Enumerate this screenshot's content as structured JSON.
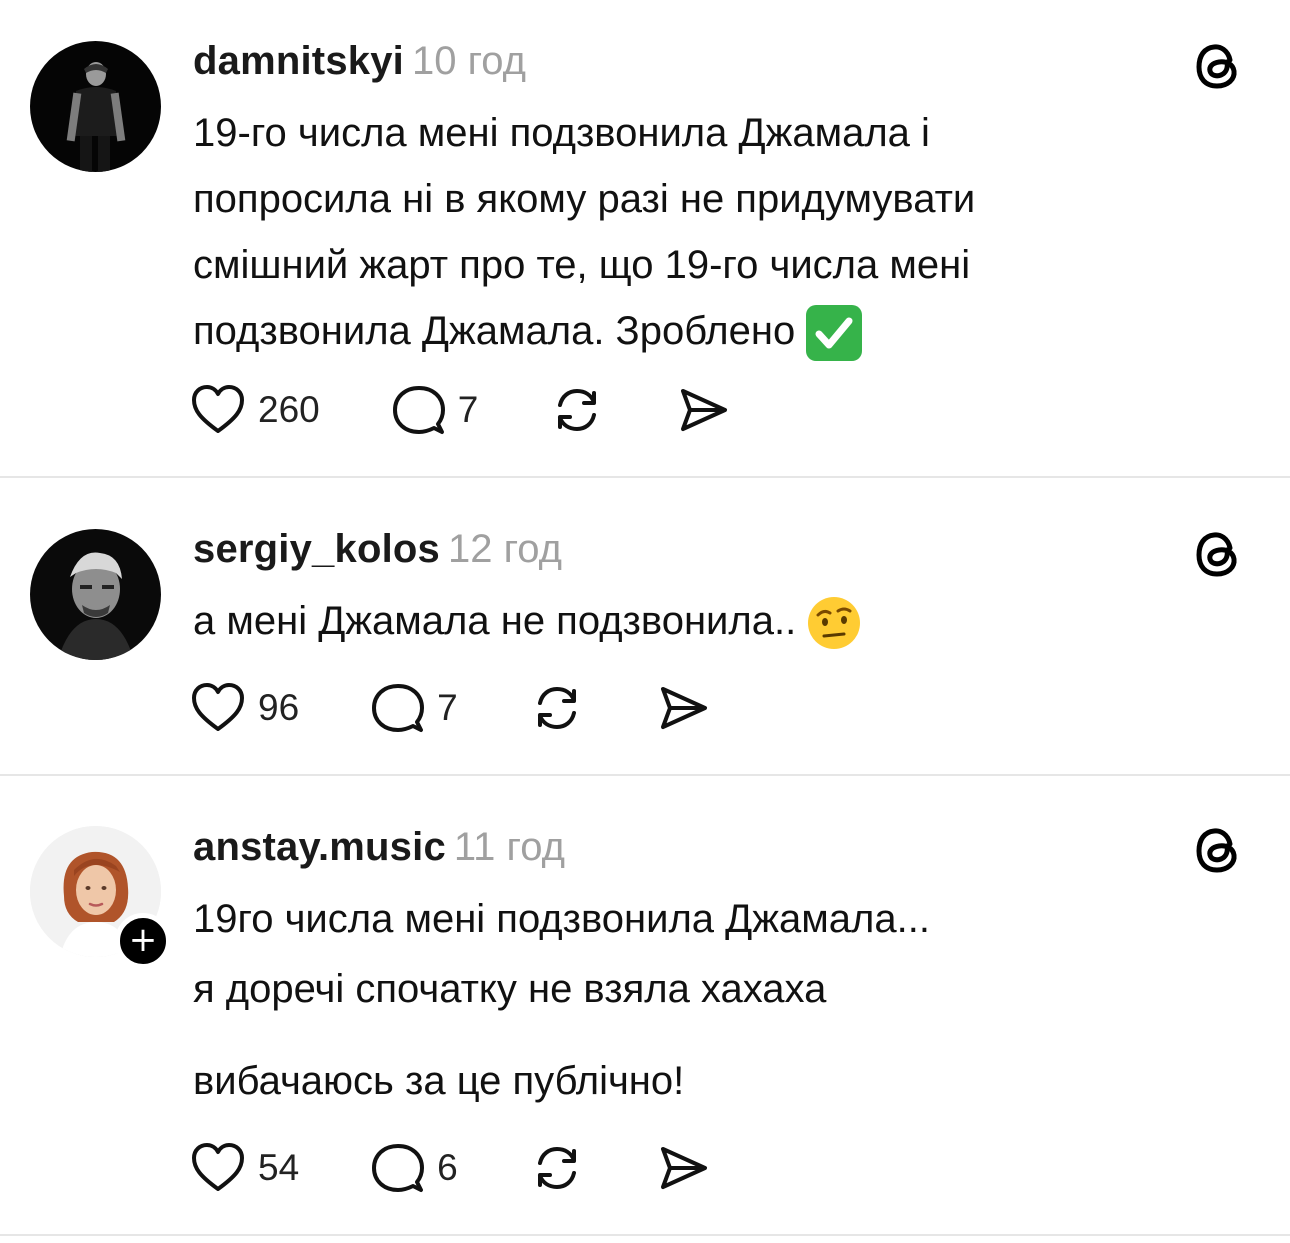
{
  "posts": [
    {
      "username": "damnitskyi",
      "time": "10 год",
      "lines": [
        "19-го числа мені подзвонила Джамала і",
        "попросила ні в якому разі не придумувати",
        "смішний жарт про те, що 19-го числа мені",
        "подзвонила Джамала. Зроблено"
      ],
      "emoji": "check-mark-button-emoji",
      "likes": "260",
      "replies": "7"
    },
    {
      "username": "sergiy_kolos",
      "time": "12 год",
      "lines": [
        "а мені Джамала не подзвонила.."
      ],
      "emoji": "face-with-raised-eyebrow-emoji",
      "likes": "96",
      "replies": "7"
    },
    {
      "username": "anstay.music",
      "time": "11 год",
      "lines": [
        "19го числа мені подзвонила Джамала...",
        "я доречі спочатку не взяла хахаха",
        "вибачаюсь за це публічно!"
      ],
      "follow_badge": "+",
      "likes": "54",
      "replies": "6"
    }
  ],
  "icons": {
    "like": "heart-icon",
    "reply": "comment-bubble-icon",
    "repost": "repost-icon",
    "share": "send-icon",
    "app": "threads-logo-icon"
  },
  "colors": {
    "text": "#111111",
    "secondary": "#a0a0a0",
    "divider": "#e6e6e6",
    "check_green": "#36b34a",
    "emoji_yellow": "#ffcc33"
  }
}
